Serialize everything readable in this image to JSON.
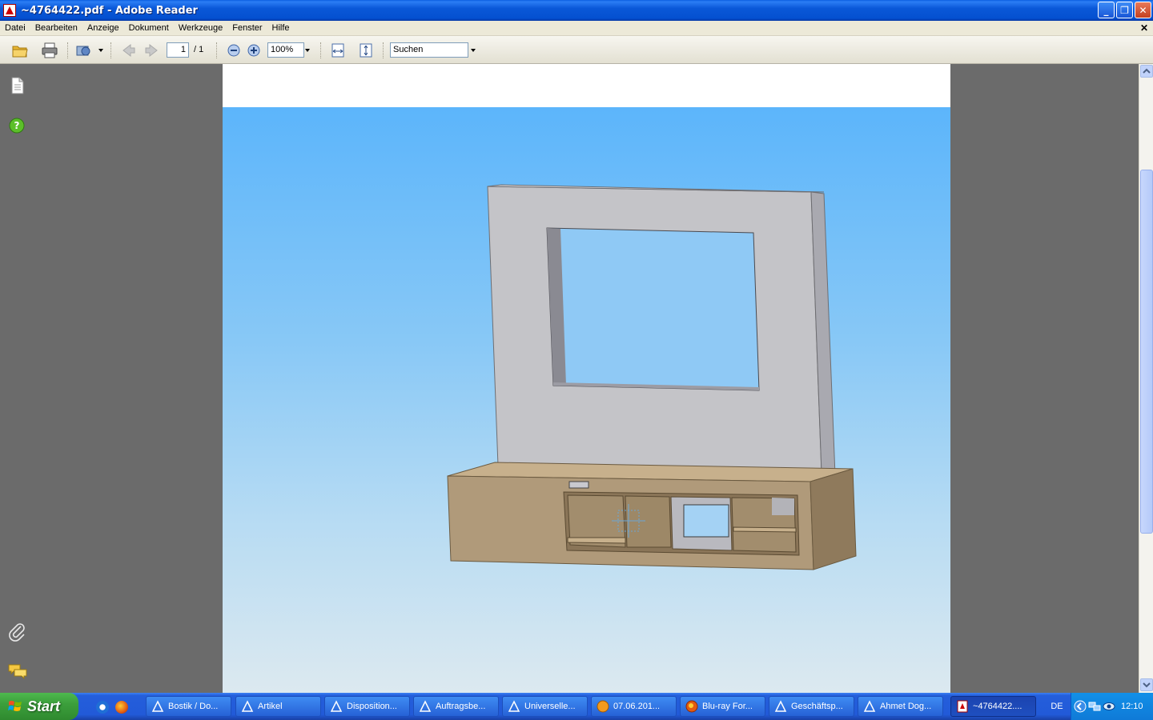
{
  "window": {
    "title": "~4764422.pdf - Adobe Reader",
    "buttons": {
      "minimize": "_",
      "restore": "❐",
      "close": "✕"
    }
  },
  "menu": {
    "items": [
      "Datei",
      "Bearbeiten",
      "Anzeige",
      "Dokument",
      "Werkzeuge",
      "Fenster",
      "Hilfe"
    ],
    "doc_close": "✕"
  },
  "toolbar": {
    "page_number": "1",
    "page_total": "/ 1",
    "zoom": "100%",
    "search_placeholder": "Suchen"
  },
  "taskbar": {
    "start_label": "Start",
    "language": "DE",
    "clock": "12:10",
    "tasks": [
      "Bostik / Do...",
      "Artikel",
      "Disposition...",
      "Auftragsbe...",
      "Universelle...",
      "07.06.201...",
      "Blu-ray For...",
      "Geschäftsp...",
      "Ahmet Dog...",
      "~4764422...."
    ]
  },
  "colors": {
    "titlebar": "#0a58d8",
    "viewer_bg": "#6b6b6b",
    "sky_top": "#5cb5fb",
    "sky_bottom": "#dce9f0",
    "panel": "#c4c4c8",
    "wood": "#b09a7a"
  }
}
